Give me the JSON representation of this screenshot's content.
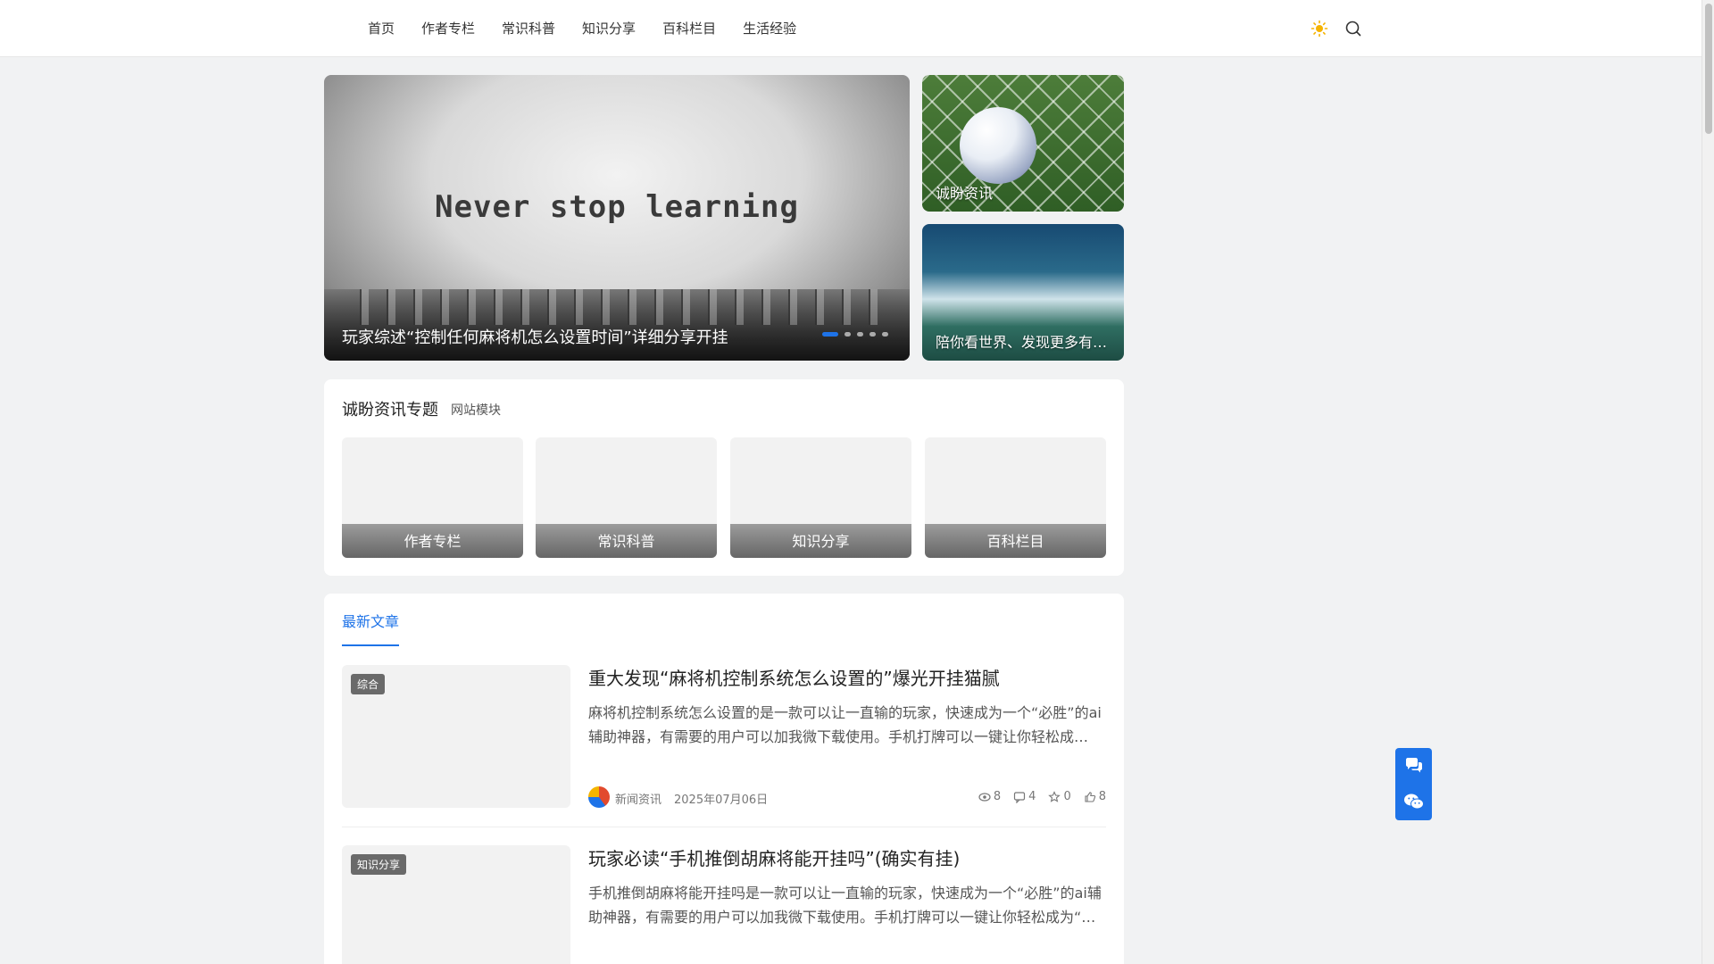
{
  "nav": {
    "items": [
      "首页",
      "作者专栏",
      "常识科普",
      "知识分享",
      "百科栏目",
      "生活经验"
    ]
  },
  "tools": {
    "theme_icon": "sun-icon",
    "search_icon": "search-icon"
  },
  "slider": {
    "headline": "Never stop learning",
    "caption": "玩家综述“控制任何麻将机怎么设置时间”详细分享开挂",
    "dots": 5,
    "active_dot": 1
  },
  "side_cards": [
    {
      "label": "诚盼资讯"
    },
    {
      "label": "陪你看世界、发现更多有趣的事"
    }
  ],
  "topics": {
    "title": "诚盼资讯专题",
    "subtitle": "网站模块",
    "tiles": [
      "作者专栏",
      "常识科普",
      "知识分享",
      "百科栏目"
    ]
  },
  "latest": {
    "tab": "最新文章",
    "posts": [
      {
        "tag": "综合",
        "title": "重大发现“麻将机控制系统怎么设置的”爆光开挂猫腻",
        "excerpt": "麻将机控制系统怎么设置的是一款可以让一直输的玩家，快速成为一个“必胜”的ai辅助神器，有需要的用户可以加我微下载使用。手机打牌可以一键让你轻松成为“必胜”。",
        "author": "新闻资讯",
        "date": "2025年07月06日",
        "views": "8",
        "comments": "4",
        "favorites": "0",
        "likes": "8"
      },
      {
        "tag": "知识分享",
        "title": "玩家必读“手机推倒胡麻将能开挂吗”(确实有挂)",
        "excerpt": "手机推倒胡麻将能开挂吗是一款可以让一直输的玩家，快速成为一个“必胜”的ai辅助神器，有需要的用户可以加我微下载使用。手机打牌可以一键让你轻松成为“必胜”。"
      }
    ]
  },
  "accent": "#1e73e8",
  "float_buttons": [
    "chat-icon",
    "wechat-icon"
  ]
}
